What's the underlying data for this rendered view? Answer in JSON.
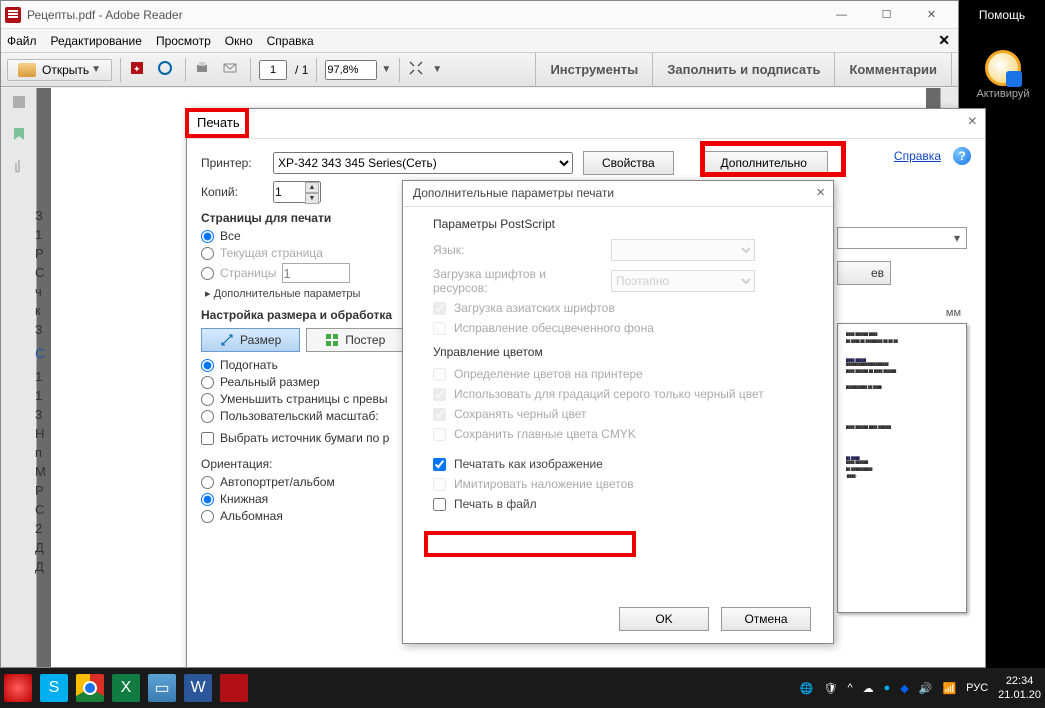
{
  "desktop": {
    "help": "Помощь"
  },
  "watermark": {
    "text": "Активируй"
  },
  "app": {
    "title": "Рецепты.pdf - Adobe Reader",
    "menu": [
      "Файл",
      "Редактирование",
      "Просмотр",
      "Окно",
      "Справка"
    ],
    "toolbar": {
      "open": "Открыть",
      "pageCurrent": "1",
      "pageTotal": "/ 1",
      "zoom": "97,8%"
    },
    "rightTools": [
      "Инструменты",
      "Заполнить и подписать",
      "Комментарии"
    ]
  },
  "sideLetters": [
    "З",
    "1",
    "Р",
    "С",
    "ч",
    "к",
    "3",
    "",
    "С",
    "",
    "1",
    "1",
    "3",
    "Н",
    "п",
    "М",
    "Р",
    "С",
    "2",
    "Д",
    "Д"
  ],
  "print": {
    "title": "Печать",
    "printerLbl": "Принтер:",
    "printerValue": "XP-342 343 345 Series(Сеть)",
    "propsBtn": "Свойства",
    "advBtn": "Дополнительно",
    "helpLink": "Справка",
    "copiesLbl": "Копий:",
    "copiesValue": "1",
    "pagesHeader": "Страницы для печати",
    "radAll": "Все",
    "radCurrent": "Текущая страница",
    "radRange": "Страницы",
    "pagesValue": "1",
    "advParams": "Дополнительные параметры",
    "sizeHeader": "Настройка размера и обработка",
    "sizeBtn": "Размер",
    "posterBtn": "Постер",
    "rFit": "Подогнать",
    "rReal": "Реальный размер",
    "rShrink": "Уменьшить страницы с превы",
    "rCustom": "Пользовательский масштаб:",
    "cSource": "Выбрать источник бумаги по р",
    "orientHeader": "Ориентация:",
    "oAuto": "Автопортрет/альбом",
    "oPort": "Книжная",
    "oLand": "Альбомная",
    "previewMm": "мм",
    "previewEv": "ев"
  },
  "adv": {
    "title": "Дополнительные параметры печати",
    "psHeader": "Параметры PostScript",
    "langLbl": "Язык:",
    "fontLoad": "Загрузка шрифтов и ресурсов:",
    "fontLoadVal": "Поэтапно",
    "cAsian": "Загрузка азиатских шрифтов",
    "cBleach": "Исправление обесцвеченного фона",
    "colorHeader": "Управление цветом",
    "cPrinter": "Определение цветов на принтере",
    "cGray": "Использовать для градаций серого только черный цвет",
    "cBlack": "Сохранять черный цвет",
    "cCMYK": "Сохранить главные цвета CMYK",
    "cAsImage": "Печатать как изображение",
    "cOverlay": "Имитировать наложение цветов",
    "cToFile": "Печать в файл",
    "ok": "OK",
    "cancel": "Отмена"
  },
  "taskbar": {
    "lang": "РУС",
    "time": "22:34",
    "date": "21.01.20"
  }
}
